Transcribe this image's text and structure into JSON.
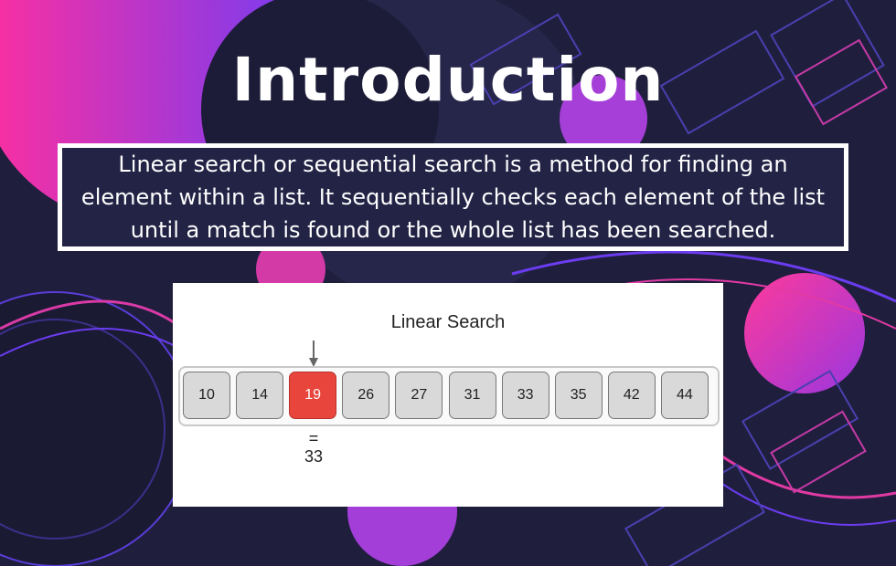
{
  "slide": {
    "title": "Introduction",
    "intro_lines": [
      "Linear search or sequential search is a method for finding an",
      "element within a list. It sequentially checks each element of the list",
      "until a match is found or the whole list has been searched."
    ]
  },
  "figure": {
    "title": "Linear Search",
    "items": [
      "10",
      "14",
      "19",
      "26",
      "27",
      "31",
      "33",
      "35",
      "42",
      "44"
    ],
    "current_index": 2,
    "compare_symbol": "=",
    "target": "33"
  },
  "colors": {
    "background": "#1f1f3d",
    "accent_pink": "#e63aa6",
    "accent_purple": "#7a3cf0",
    "active_cell": "#e8463c"
  }
}
